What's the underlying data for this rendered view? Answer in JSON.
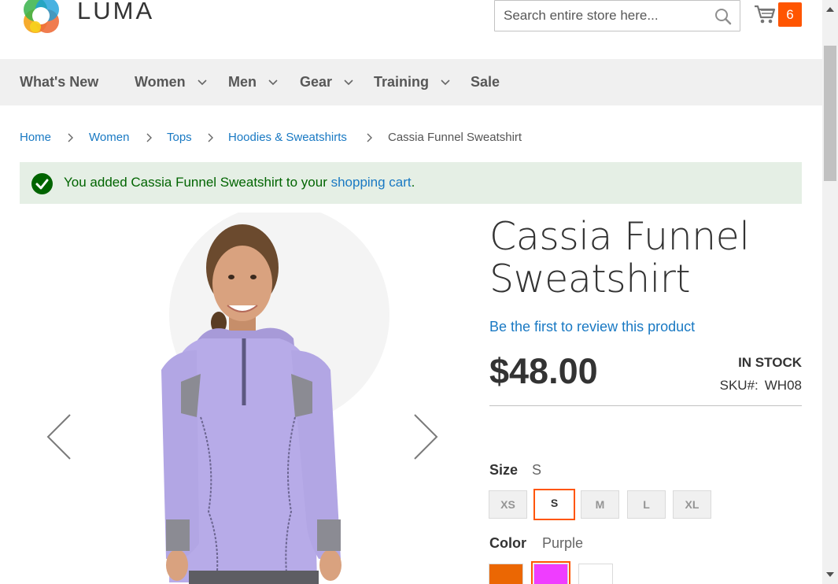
{
  "header": {
    "logo_text": "LUMA",
    "search_placeholder": "Search entire store here...",
    "cart_count": "6"
  },
  "nav": {
    "items": [
      {
        "label": "What's New",
        "has_dropdown": false
      },
      {
        "label": "Women",
        "has_dropdown": true
      },
      {
        "label": "Men",
        "has_dropdown": true
      },
      {
        "label": "Gear",
        "has_dropdown": true
      },
      {
        "label": "Training",
        "has_dropdown": true
      },
      {
        "label": "Sale",
        "has_dropdown": false
      }
    ]
  },
  "breadcrumb": [
    "Home",
    "Women",
    "Tops",
    "Hoodies & Sweatshirts",
    "Cassia Funnel Sweatshirt"
  ],
  "message": {
    "text_before": "You added Cassia Funnel Sweatshirt to your ",
    "link": "shopping cart",
    "text_after": "."
  },
  "product": {
    "title": "Cassia Funnel Sweatshirt",
    "review_link": "Be the first to review this product",
    "price": "$48.00",
    "stock": "In stock",
    "sku_label": "SKU#:",
    "sku": "WH08",
    "size_label": "Size",
    "size_selected": "S",
    "sizes": [
      "XS",
      "S",
      "M",
      "L",
      "XL"
    ],
    "color_label": "Color",
    "color_selected": "Purple",
    "colors": [
      "#eb6703",
      "#ef3dff",
      "#ffffff"
    ]
  }
}
